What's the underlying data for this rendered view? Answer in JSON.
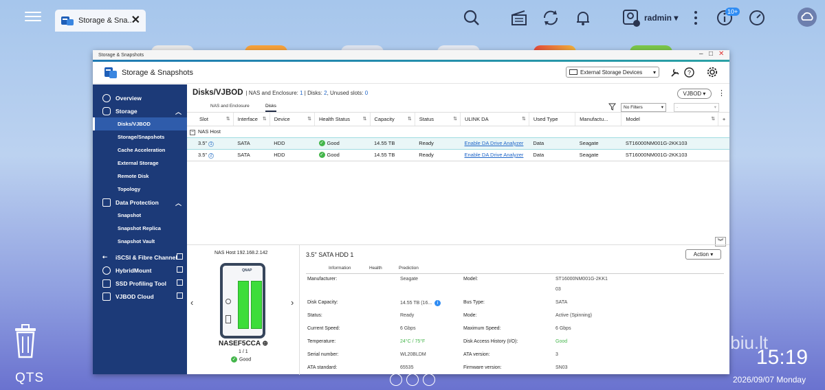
{
  "topbar": {
    "tab_label": "Storage & Sna...",
    "user": "radmin",
    "notif_count": "10+"
  },
  "desktop": {
    "os_label": "QTS",
    "time": "15:19",
    "date": "2026/09/07 Monday",
    "watermark": "skelbiu.lt"
  },
  "window": {
    "title": "Storage & Snapshots",
    "app_title": "Storage & Snapshots",
    "external_devices": "External Storage Devices",
    "window_controls": [
      "–",
      "□",
      "✕"
    ]
  },
  "sidebar": {
    "items": [
      {
        "label": "Overview",
        "icon": "gauge-icon"
      },
      {
        "label": "Storage",
        "icon": "database-icon",
        "expanded": true,
        "children": [
          "Disks/VJBOD",
          "Storage/Snapshots",
          "Cache Acceleration",
          "External Storage",
          "Remote Disk",
          "Topology"
        ]
      },
      {
        "label": "Data Protection",
        "icon": "shield-icon",
        "expanded": true,
        "children": [
          "Snapshot",
          "Snapshot Replica",
          "Snapshot Vault"
        ]
      },
      {
        "label": "iSCSI & Fibre Channel",
        "icon": "iscsi-icon",
        "external": true
      },
      {
        "label": "HybridMount",
        "icon": "cloud-mount-icon",
        "external": true
      },
      {
        "label": "SSD Profiling Tool",
        "icon": "ssd-icon",
        "external": true
      },
      {
        "label": "VJBOD Cloud",
        "icon": "vjbod-cloud-icon",
        "external": true
      }
    ],
    "active": "Disks/VJBOD"
  },
  "content": {
    "title": "Disks/VJBOD",
    "nas_label": "NAS and Enclosure:",
    "nas_count": "1",
    "disks_label": "Disks:",
    "disks_count": "2",
    "unused_label": "Unused slots:",
    "unused_count": "0",
    "vjbod_button": "VJBOD",
    "tabs": [
      "NAS and Enclosure",
      "Disks"
    ],
    "active_tab": "Disks",
    "filter_value": "No Filters",
    "filter_value2": "-"
  },
  "table": {
    "columns": [
      "Slot",
      "Interface",
      "Device",
      "Health Status",
      "Capacity",
      "Status",
      "ULINK DA",
      "Used Type",
      "Manufactu...",
      "Model"
    ],
    "group": "NAS Host",
    "rows": [
      {
        "slot": "3.5\"",
        "slot_num": "1",
        "interface": "SATA",
        "device": "HDD",
        "health": "Good",
        "capacity": "14.55 TB",
        "status": "Ready",
        "ulink": "Enable DA Drive Analyzer",
        "used_type": "Data",
        "manufacturer": "Seagate",
        "model": "ST16000NM001G-2KK103"
      },
      {
        "slot": "3.5\"",
        "slot_num": "2",
        "interface": "SATA",
        "device": "HDD",
        "health": "Good",
        "capacity": "14.55 TB",
        "status": "Ready",
        "ulink": "Enable DA Drive Analyzer",
        "used_type": "Data",
        "manufacturer": "Seagate",
        "model": "ST16000NM001G-2KK103"
      }
    ]
  },
  "nas": {
    "host_label": "NAS Host 192.168.2.142",
    "name": "NASEF5CCA",
    "count": "1 / 1",
    "status": "Good",
    "brand": "QNAP"
  },
  "detail": {
    "title": "3.5\" SATA HDD 1",
    "action": "Action",
    "tabs": [
      "Information",
      "Health",
      "Prediction"
    ],
    "left": [
      {
        "label": "Manufacturer:",
        "value": "Seagate"
      },
      {
        "label": "Disk Capacity:",
        "value": "14.55 TB (16..."
      },
      {
        "label": "Status:",
        "value": "Ready"
      },
      {
        "label": "Current Speed:",
        "value": "6 Gbps"
      },
      {
        "label": "Temperature:",
        "value": "24°C / 75°F"
      },
      {
        "label": "Serial number:",
        "value": "WL20BLDM"
      },
      {
        "label": "ATA standard:",
        "value": "65535"
      }
    ],
    "right": [
      {
        "label": "Model:",
        "value": "ST16000NM001G-2KK1",
        "value2": "03"
      },
      {
        "label": "Bus Type:",
        "value": "SATA"
      },
      {
        "label": "Mode:",
        "value": "Active (Spinning)"
      },
      {
        "label": "Maximum Speed:",
        "value": "6 Gbps"
      },
      {
        "label": "Disk Access History (I/O):",
        "value": "Good"
      },
      {
        "label": "ATA version:",
        "value": "3"
      },
      {
        "label": "Firmware version:",
        "value": "SN03"
      }
    ]
  }
}
